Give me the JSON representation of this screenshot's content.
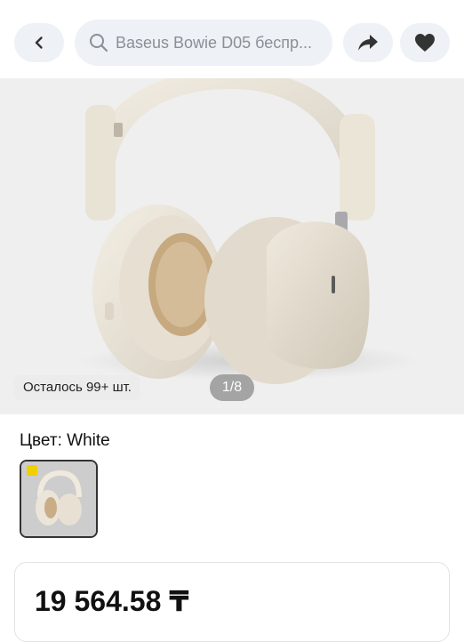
{
  "header": {
    "back_icon": "chevron-left-icon",
    "search_icon": "search-icon",
    "search_text": "Baseus Bowie D05 беспр...",
    "share_icon": "share-arrow-icon",
    "favorite_icon": "heart-icon"
  },
  "gallery": {
    "stock_label": "Осталось 99+ шт.",
    "counter": "1/8"
  },
  "color": {
    "label": "Цвет: White",
    "selected_swatch": "White"
  },
  "price_card": {
    "price": "19 564.58 ₸"
  },
  "colors": {
    "button_bg": "#eef1f5",
    "icon": "#333333",
    "gallery_bg": "#efefef"
  }
}
